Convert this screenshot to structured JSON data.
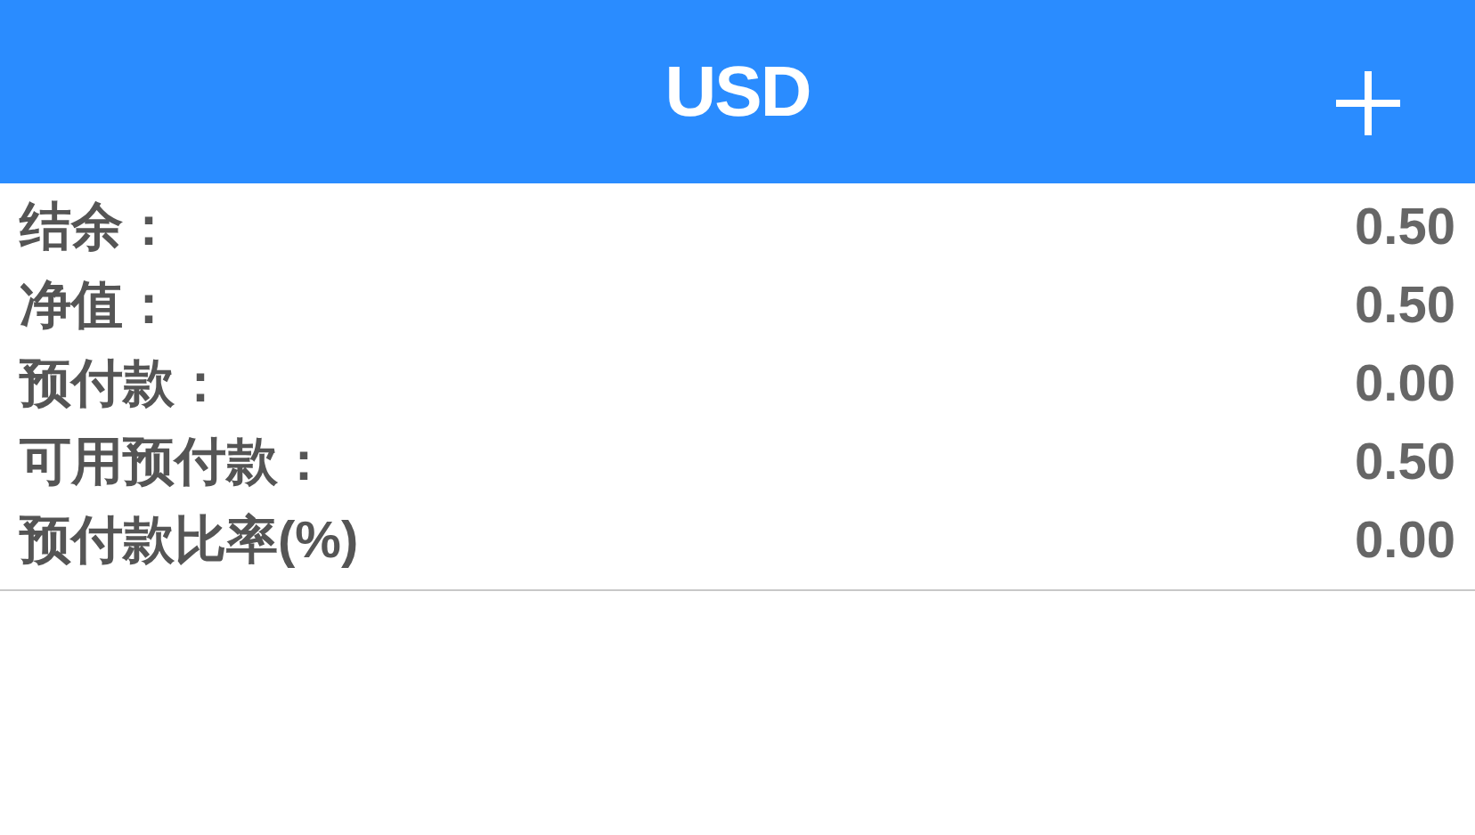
{
  "header": {
    "title": "USD"
  },
  "rows": [
    {
      "label": "结余：",
      "value": "0.50"
    },
    {
      "label": "净值：",
      "value": "0.50"
    },
    {
      "label": "预付款：",
      "value": "0.00"
    },
    {
      "label": "可用预付款：",
      "value": "0.50"
    },
    {
      "label": "预付款比率(%)",
      "value": "0.00"
    }
  ]
}
